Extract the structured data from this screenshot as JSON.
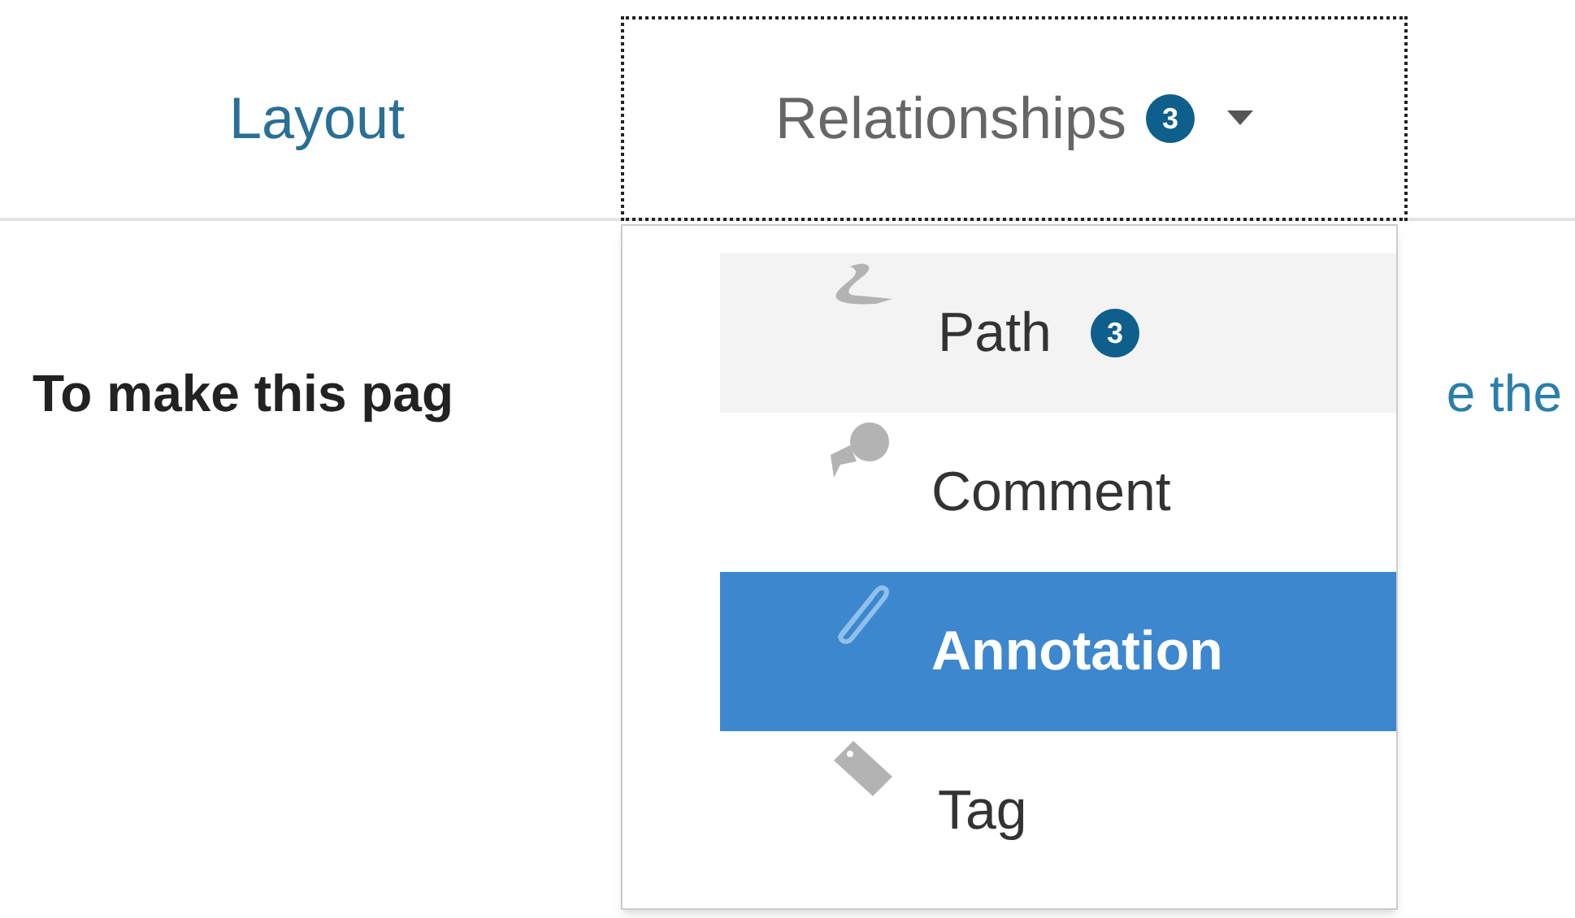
{
  "tabs": [
    {
      "label": "Layout",
      "selected": false
    },
    {
      "label": "Relationships",
      "selected": true,
      "badge": "3"
    }
  ],
  "intro": {
    "text": "To make this pag",
    "link": "e the"
  },
  "menu": [
    {
      "kind": "path",
      "label": "Path",
      "badge": "3",
      "hovered": true,
      "selected": false
    },
    {
      "kind": "comment",
      "label": "Comment",
      "hovered": false,
      "selected": false
    },
    {
      "kind": "annotation",
      "label": "Annotation",
      "hovered": false,
      "selected": true
    },
    {
      "kind": "tag",
      "label": "Tag",
      "hovered": false,
      "selected": false
    }
  ]
}
